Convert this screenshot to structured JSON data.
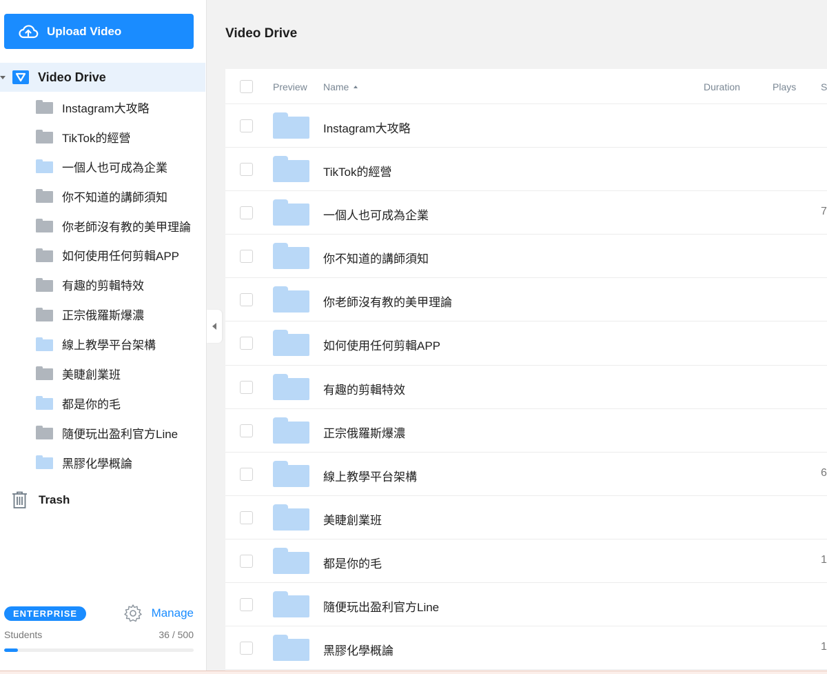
{
  "sidebar": {
    "upload_label": "Upload Video",
    "drive_label": "Video Drive",
    "folders": [
      {
        "label": "Instagram大攻略",
        "color": "gray"
      },
      {
        "label": "TikTok的經營",
        "color": "gray"
      },
      {
        "label": "一個人也可成為企業",
        "color": "blue"
      },
      {
        "label": "你不知道的講師須知",
        "color": "gray"
      },
      {
        "label": "你老師沒有教的美甲理論",
        "color": "gray"
      },
      {
        "label": "如何使用任何剪輯APP",
        "color": "gray"
      },
      {
        "label": "有趣的剪輯特效",
        "color": "gray"
      },
      {
        "label": "正宗俄羅斯爆濃",
        "color": "gray"
      },
      {
        "label": "線上教學平台架構",
        "color": "blue"
      },
      {
        "label": "美睫創業班",
        "color": "gray"
      },
      {
        "label": "都是你的毛",
        "color": "blue"
      },
      {
        "label": "隨便玩出盈利官方Line",
        "color": "gray"
      },
      {
        "label": "黑膠化學概論",
        "color": "blue"
      }
    ],
    "trash_label": "Trash",
    "plan_badge": "ENTERPRISE",
    "manage_label": "Manage",
    "students_label": "Students",
    "students_count": "36 / 500",
    "students_fraction": 0.072
  },
  "main": {
    "title": "Video Drive",
    "columns": {
      "preview": "Preview",
      "name": "Name",
      "duration": "Duration",
      "plays": "Plays",
      "size": "S"
    },
    "rows": [
      {
        "name": "Instagram大攻略",
        "size": ""
      },
      {
        "name": "TikTok的經營",
        "size": ""
      },
      {
        "name": "一個人也可成為企業",
        "size": "7"
      },
      {
        "name": "你不知道的講師須知",
        "size": ""
      },
      {
        "name": "你老師沒有教的美甲理論",
        "size": ""
      },
      {
        "name": "如何使用任何剪輯APP",
        "size": ""
      },
      {
        "name": "有趣的剪輯特效",
        "size": ""
      },
      {
        "name": "正宗俄羅斯爆濃",
        "size": ""
      },
      {
        "name": "線上教學平台架構",
        "size": "6"
      },
      {
        "name": "美睫創業班",
        "size": ""
      },
      {
        "name": "都是你的毛",
        "size": "1"
      },
      {
        "name": "隨便玩出盈利官方Line",
        "size": ""
      },
      {
        "name": "黑膠化學概論",
        "size": "1"
      }
    ]
  },
  "colors": {
    "accent": "#1a8cff",
    "folder_gray": "#b0b6bd",
    "folder_blue": "#b9d8f7"
  }
}
